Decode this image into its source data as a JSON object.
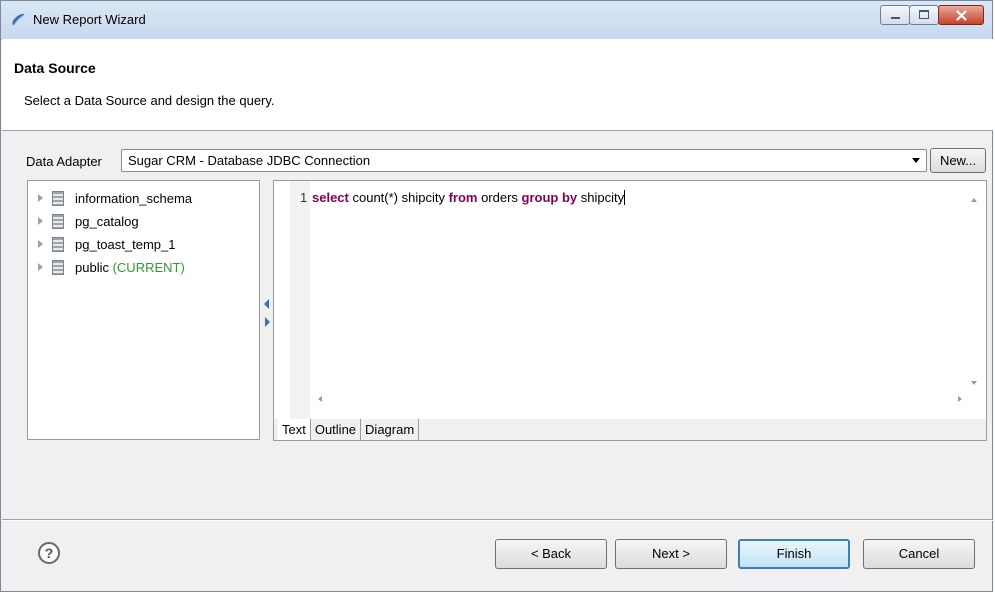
{
  "window": {
    "title": "New Report Wizard",
    "icons": {
      "app": "eclipse-icon",
      "minimize": "minimize-icon",
      "maximize": "maximize-icon",
      "close": "close-icon"
    }
  },
  "header": {
    "title": "Data Source",
    "description": "Select a Data Source and design the query."
  },
  "adapter": {
    "label": "Data Adapter",
    "selected": "Sugar CRM - Database JDBC Connection",
    "new_label": "New..."
  },
  "schemas": [
    {
      "name": "information_schema",
      "suffix": ""
    },
    {
      "name": "pg_catalog",
      "suffix": ""
    },
    {
      "name": "pg_toast_temp_1",
      "suffix": ""
    },
    {
      "name": "public",
      "suffix": "(CURRENT)"
    }
  ],
  "editor": {
    "line_number": "1",
    "tokens": [
      {
        "text": "select",
        "kw": true
      },
      {
        "text": " count(*) shipcity ",
        "kw": false
      },
      {
        "text": "from",
        "kw": true
      },
      {
        "text": " orders ",
        "kw": false
      },
      {
        "text": "group by",
        "kw": true
      },
      {
        "text": " shipcity",
        "kw": false
      }
    ]
  },
  "editor_tabs": [
    {
      "label": "Text",
      "active": true
    },
    {
      "label": "Outline",
      "active": false
    },
    {
      "label": "Diagram",
      "active": false
    }
  ],
  "footer": {
    "help_icon": "help-icon",
    "back_label": "< Back",
    "next_label": "Next >",
    "finish_label": "Finish",
    "cancel_label": "Cancel"
  },
  "colors": {
    "keyword": "#7f0055",
    "current": "#2f9a2f",
    "default_button_border": "#3c7fb1"
  }
}
